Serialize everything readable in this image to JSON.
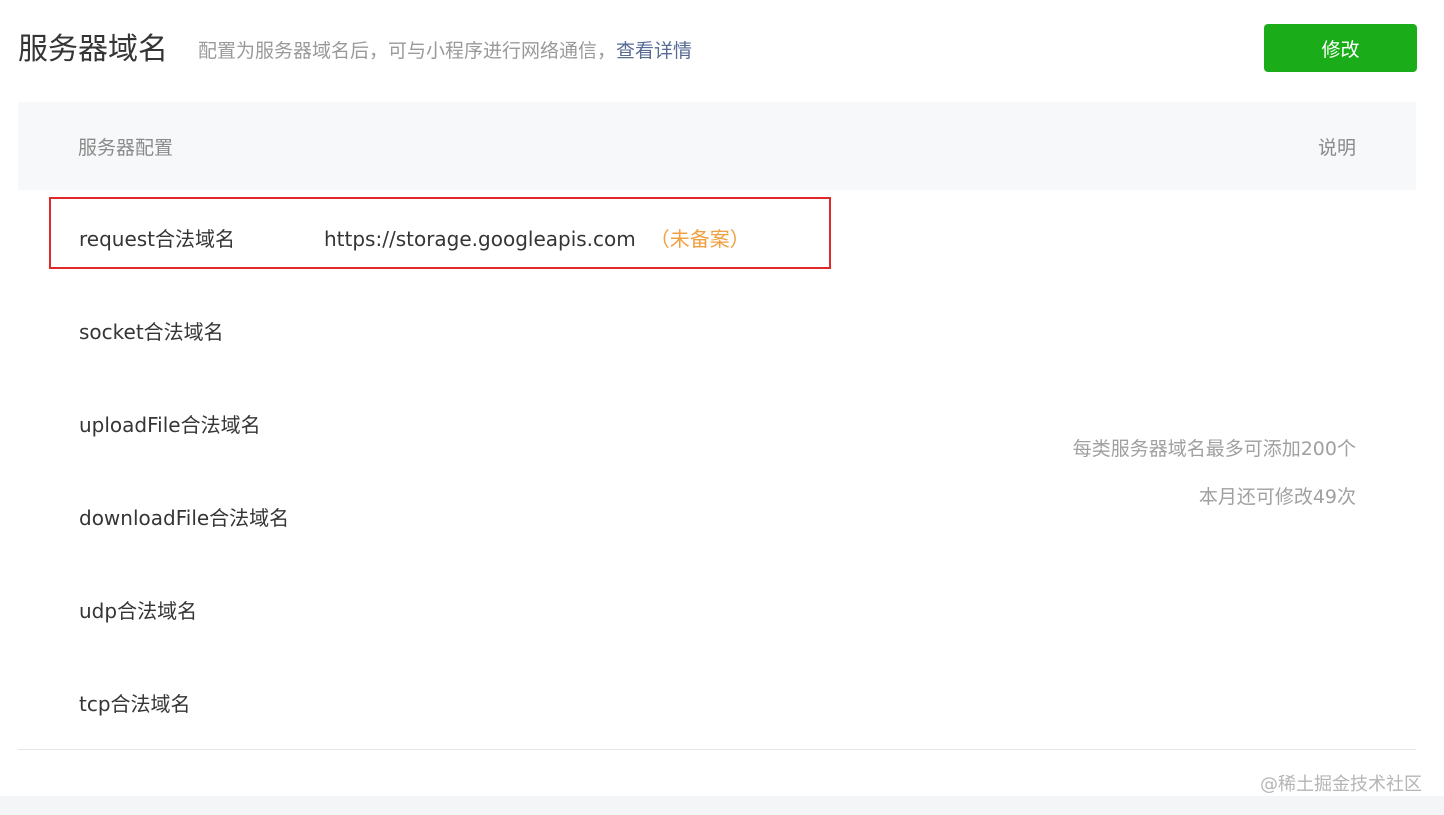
{
  "header": {
    "title": "服务器域名",
    "subtitle": "配置为服务器域名后，可与小程序进行网络通信，",
    "details_link": "查看详情",
    "edit_button": "修改"
  },
  "table": {
    "col_config": "服务器配置",
    "col_desc": "说明",
    "rows": [
      {
        "label": "request合法域名",
        "value": "https://storage.googleapis.com",
        "status": "（未备案）"
      },
      {
        "label": "socket合法域名"
      },
      {
        "label": "uploadFile合法域名"
      },
      {
        "label": "downloadFile合法域名"
      },
      {
        "label": "udp合法域名"
      },
      {
        "label": "tcp合法域名"
      }
    ],
    "note_line1": "每类服务器域名最多可添加200个",
    "note_line2": "本月还可修改49次"
  },
  "watermark": "@稀土掘金技术社区",
  "colors": {
    "primary_green": "#1aad19",
    "link_blue": "#576b95",
    "warning_orange": "#f0a040",
    "highlight_red": "#e02a2a"
  }
}
